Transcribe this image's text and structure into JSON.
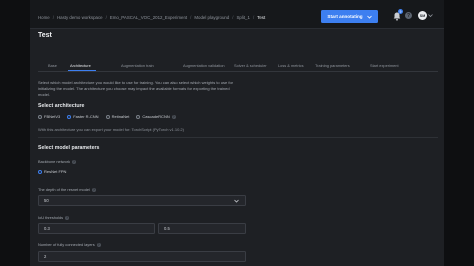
{
  "breadcrumbs": [
    "Home",
    "Hasty demo workspace",
    "Emo_PASCAL_VOC_2012_Experiment",
    "Model playground",
    "Split_1",
    "Test"
  ],
  "header": {
    "primary_button": "Start annotating",
    "notification_count": "9",
    "help_glyph": "?",
    "avatar_initials": "SM"
  },
  "page": {
    "title": "Test"
  },
  "tabs": [
    {
      "label": "Base"
    },
    {
      "label": "Architecture"
    },
    {
      "label": "Augmentation train"
    },
    {
      "label": "Augmentation validation"
    },
    {
      "label": "Solver & scheduler"
    },
    {
      "label": "Loss & metrics"
    },
    {
      "label": "Training parameters"
    },
    {
      "label": "Start experiment"
    }
  ],
  "architecture": {
    "description": "Select which model architecture you would like to use for training. You can also select which weights to use for initializing the model. The architecture you choose may impact the available formats for exporting the trained model.",
    "section_title": "Select architecture",
    "options": [
      "FBNetV3",
      "Faster R-CNN",
      "RetinaNet",
      "CascadeRCNN"
    ],
    "selected": "Faster R-CNN",
    "export_note": "With this architecture you can export your model for: TorchScript (PyTorch v1.10.2)"
  },
  "params": {
    "section_title": "Select model parameters",
    "backbone_label": "Backbone network",
    "backbone_value": "ResNet FPN",
    "depth_label": "The depth of the resnet model",
    "depth_value": "50",
    "iou_label": "IoU thresholds",
    "iou_values": [
      "0.3",
      "0.5"
    ],
    "fc_layers_label": "Number of fully connected layers",
    "fc_layers_value": "2"
  },
  "colors": {
    "accent": "#3d7ff0",
    "background": "#1e2024",
    "topbar": "#16181b"
  },
  "icons": {
    "bell": "bell-icon",
    "help": "help-icon",
    "info": "info-icon",
    "chevron": "chevron-down-icon"
  }
}
